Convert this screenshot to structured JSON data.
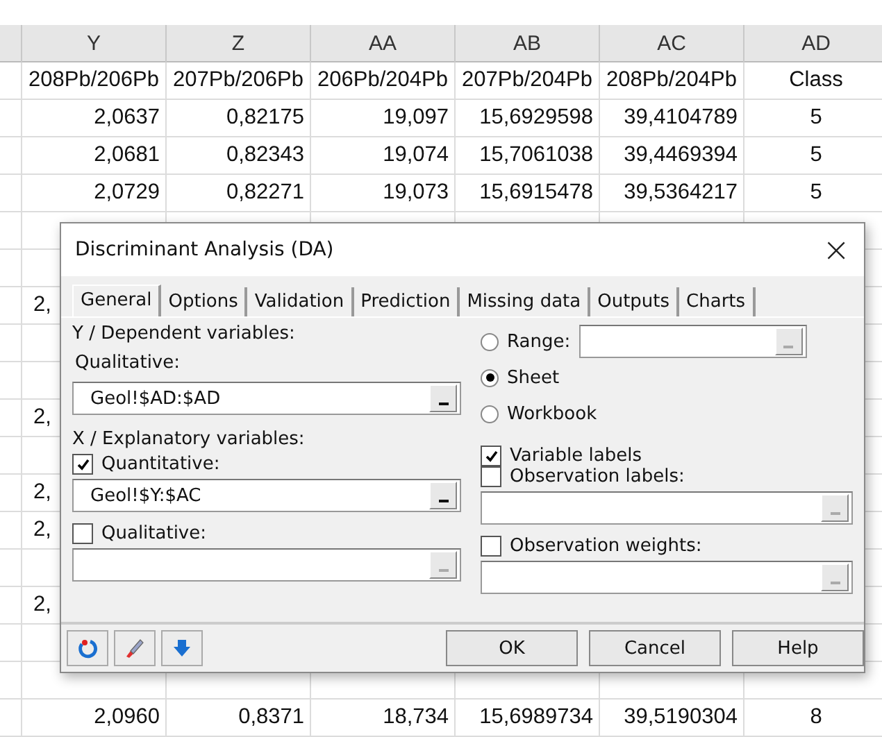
{
  "sheet": {
    "columns": [
      "Y",
      "Z",
      "AA",
      "AB",
      "AC",
      "AD"
    ],
    "rows": [
      {
        "kind": "header",
        "cells": [
          "208Pb/206Pb",
          "207Pb/206Pb",
          "206Pb/204Pb",
          "207Pb/204Pb",
          "208Pb/204Pb",
          "Class"
        ]
      },
      {
        "kind": "full",
        "cells": [
          "2,0637",
          "0,82175",
          "19,097",
          "15,6929598",
          "39,4104789",
          "5"
        ]
      },
      {
        "kind": "full",
        "cells": [
          "2,0681",
          "0,82343",
          "19,074",
          "15,7061038",
          "39,4469394",
          "5"
        ]
      },
      {
        "kind": "full",
        "cells": [
          "2,0729",
          "0,82271",
          "19,073",
          "15,6915478",
          "39,5364217",
          "5"
        ]
      },
      {
        "kind": "blank",
        "cells": []
      },
      {
        "kind": "blank",
        "cells": []
      },
      {
        "kind": "fragment",
        "cells": [
          "2,"
        ]
      },
      {
        "kind": "blank",
        "cells": []
      },
      {
        "kind": "blank",
        "cells": []
      },
      {
        "kind": "fragment",
        "cells": [
          "2,"
        ]
      },
      {
        "kind": "blank",
        "cells": []
      },
      {
        "kind": "fragment",
        "cells": [
          "2,"
        ]
      },
      {
        "kind": "fragment",
        "cells": [
          "2,"
        ]
      },
      {
        "kind": "blank",
        "cells": []
      },
      {
        "kind": "fragment",
        "cells": [
          "2,"
        ]
      },
      {
        "kind": "blank",
        "cells": []
      },
      {
        "kind": "blank",
        "cells": []
      },
      {
        "kind": "full",
        "cells": [
          "2,0960",
          "0,8371",
          "18,734",
          "15,6989734",
          "39,5190304",
          "8"
        ]
      }
    ]
  },
  "dialog": {
    "title": "Discriminant Analysis (DA)",
    "close": "×",
    "tabs": [
      {
        "label": "General",
        "selected": true
      },
      {
        "label": "Options",
        "selected": false
      },
      {
        "label": "Validation",
        "selected": false
      },
      {
        "label": "Prediction",
        "selected": false
      },
      {
        "label": "Missing data",
        "selected": false
      },
      {
        "label": "Outputs",
        "selected": false
      },
      {
        "label": "Charts",
        "selected": false
      }
    ],
    "left": {
      "y_heading": "Y / Dependent variables:",
      "y_qualitative": {
        "label": "Qualitative:",
        "value": "Geol!$AD:$AD"
      },
      "x_heading": "X / Explanatory variables:",
      "x_items": [
        {
          "label": "Quantitative:",
          "checked": true,
          "value": "Geol!$Y:$AC"
        },
        {
          "label": "Qualitative:",
          "checked": false,
          "value": ""
        }
      ]
    },
    "right": {
      "radios": [
        {
          "label": "Range:",
          "selected": false
        },
        {
          "label": "Sheet",
          "selected": true
        },
        {
          "label": "Workbook",
          "selected": false
        }
      ],
      "checks": [
        {
          "label": "Variable labels",
          "checked": true,
          "kind": "plain"
        },
        {
          "label": "Observation labels:",
          "checked": false,
          "kind": "with_field"
        },
        {
          "label": "Observation weights:",
          "checked": false,
          "kind": "with_field"
        }
      ]
    },
    "buttons": [
      "OK",
      "Cancel",
      "Help"
    ]
  }
}
